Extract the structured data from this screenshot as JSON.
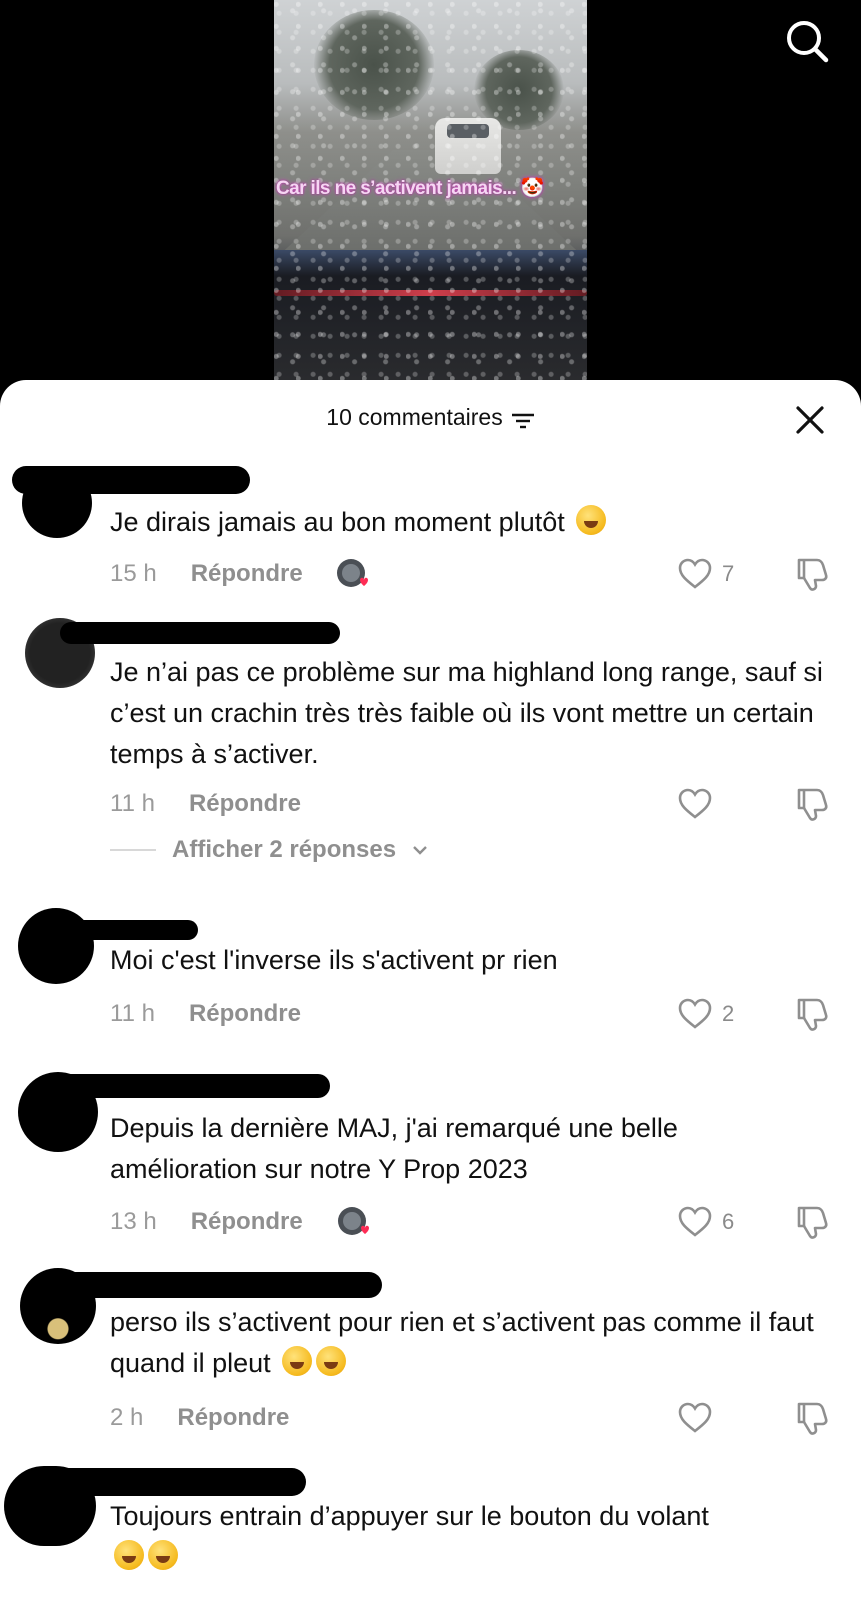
{
  "video": {
    "overlay_text": "Car ils ne s’activent jamais... 🤡"
  },
  "header": {
    "comment_count": "10 commentaires"
  },
  "comments": [
    {
      "text": "Je dirais jamais au bon moment plutôt",
      "emoji": "🤣",
      "time": "15 h",
      "reply_label": "Répondre",
      "likes": "7",
      "liked_by_author": true
    },
    {
      "text": "Je n’ai pas ce problème sur ma highland long range, sauf si c’est un crachin très très faible où ils vont mettre un certain temps à s’activer.",
      "time": "11 h",
      "reply_label": "Répondre",
      "likes": "",
      "liked_by_author": false,
      "replies_toggle": "Afficher 2 réponses"
    },
    {
      "text": "Moi c'est l'inverse ils s'activent pr rien",
      "time": "11 h",
      "reply_label": "Répondre",
      "likes": "2",
      "liked_by_author": false
    },
    {
      "text": "Depuis la dernière MAJ, j'ai remarqué une belle amélioration sur notre Y Prop 2023",
      "time": "13 h",
      "reply_label": "Répondre",
      "likes": "6",
      "liked_by_author": true
    },
    {
      "text": "perso ils s’activent pour rien et s’activent pas comme il faut quand il pleut",
      "emoji": "🤣🤣",
      "time": "2 h",
      "reply_label": "Répondre",
      "likes": "",
      "liked_by_author": false
    },
    {
      "text": "Toujours entrain d’appuyer sur le bouton du volant",
      "emoji": "😂😂",
      "time": "",
      "reply_label": "",
      "likes": "",
      "liked_by_author": false
    }
  ],
  "colors": {
    "heart_red": "#fe2c55",
    "meta_gray": "#9a9a9a",
    "overlay_pink": "#f6d6f3"
  },
  "icons": [
    "search-icon",
    "sort-icon",
    "close-icon",
    "heart-icon",
    "dislike-icon",
    "chevron-down-icon"
  ]
}
